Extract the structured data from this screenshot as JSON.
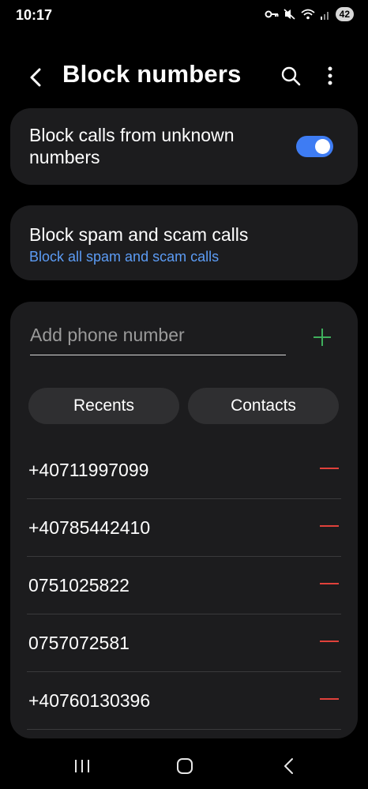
{
  "status_bar": {
    "time": "10:17",
    "battery": "42"
  },
  "app_bar": {
    "title": "Block numbers"
  },
  "unknown_card": {
    "label": "Block calls from unknown numbers",
    "toggle_on": true
  },
  "spam_card": {
    "title": "Block spam and scam calls",
    "subtitle": "Block all spam and scam calls"
  },
  "add_number": {
    "placeholder": "Add phone number",
    "value": ""
  },
  "chips": {
    "recents": "Recents",
    "contacts": "Contacts"
  },
  "blocked_numbers": [
    "+40711997099",
    "+40785442410",
    "0751025822",
    "0757072581",
    "+40760130396"
  ],
  "colors": {
    "accent": "#3e7cf3",
    "link": "#5c9cf5",
    "add": "#3fae5c",
    "remove": "#e0413b",
    "card": "#1c1c1e"
  },
  "icons": {
    "back": "chevron-left-icon",
    "search": "search-icon",
    "more": "more-vertical-icon",
    "add": "plus-icon",
    "remove": "minus-icon",
    "nav_recents": "recent-apps-icon",
    "nav_home": "home-icon",
    "nav_back": "back-icon"
  }
}
